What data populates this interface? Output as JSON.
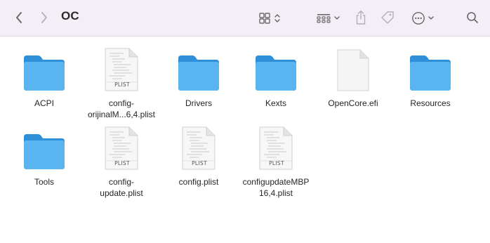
{
  "window": {
    "title": "OC"
  },
  "toolbar": {
    "icons": [
      "chevron-left-icon",
      "chevron-right-icon",
      "grid-view-icon",
      "group-icon",
      "share-icon",
      "tag-icon",
      "more-icon",
      "search-icon"
    ]
  },
  "files": [
    {
      "name": "ACPI",
      "kind": "folder",
      "badge": ""
    },
    {
      "name": "config-orijinalM...6,4.plist",
      "line1": "config-",
      "line2": "orijinalM...6,4.plist",
      "kind": "plist",
      "badge": "PLIST"
    },
    {
      "name": "Drivers",
      "kind": "folder",
      "badge": ""
    },
    {
      "name": "Kexts",
      "kind": "folder",
      "badge": ""
    },
    {
      "name": "OpenCore.efi",
      "kind": "file",
      "badge": ""
    },
    {
      "name": "Resources",
      "kind": "folder",
      "badge": ""
    },
    {
      "name": "Tools",
      "kind": "folder",
      "badge": ""
    },
    {
      "name": "config-update.plist",
      "line1": "config-",
      "line2": "update.plist",
      "kind": "plist",
      "badge": "PLIST"
    },
    {
      "name": "config.plist",
      "kind": "plist",
      "badge": "PLIST"
    },
    {
      "name": "configupdateMBP16,4.plist",
      "line1": "configupdateMBP",
      "line2": "16,4.plist",
      "kind": "plist",
      "badge": "PLIST"
    }
  ],
  "colors": {
    "toolbar_bg": "#f4eef6",
    "folder_blue": "#5ab4f0",
    "folder_tab": "#2f8fd9"
  }
}
